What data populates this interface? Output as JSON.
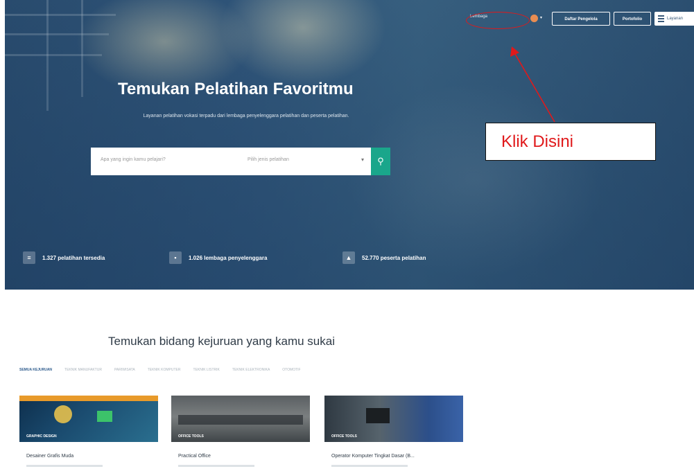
{
  "nav": {
    "login_link": "Lembaga",
    "btn_lembaga": "Daftar Pengelola",
    "btn_portofolio": "Portofolio",
    "menu_label": "Layanan"
  },
  "hero": {
    "title": "Temukan Pelatihan Favoritmu",
    "subtitle": "Layanan pelatihan vokasi terpadu dari lembaga penyelenggara pelatihan dan peserta pelatihan.",
    "search_placeholder": "Apa yang ingin kamu pelajari?",
    "select_placeholder": "Pilih jenis pelatihan",
    "stats": [
      {
        "label": "1.327 pelatihan tersedia"
      },
      {
        "label": "1.026 lembaga penyelenggara"
      },
      {
        "label": "52.770 peserta pelatihan"
      }
    ]
  },
  "annotation": {
    "callout": "Klik Disini"
  },
  "section": {
    "title": "Temukan bidang kejuruan yang kamu sukai",
    "tabs": [
      "SEMUA KEJURUAN",
      "TEKNIK MANUFAKTUR",
      "PARIWISATA",
      "TEKNIK KOMPUTER",
      "TEKNIK LISTRIK",
      "TEKNIK ELEKTRONIKA",
      "OTOMOTIF"
    ]
  },
  "cards": [
    {
      "tag": "GRAPHIC DESIGN",
      "title": "Desainer Grafis Muda"
    },
    {
      "tag": "OFFICE TOOLS",
      "title": "Practical Office"
    },
    {
      "tag": "OFFICE TOOLS",
      "title": "Operator Komputer Tingkat Dasar (B..."
    }
  ]
}
